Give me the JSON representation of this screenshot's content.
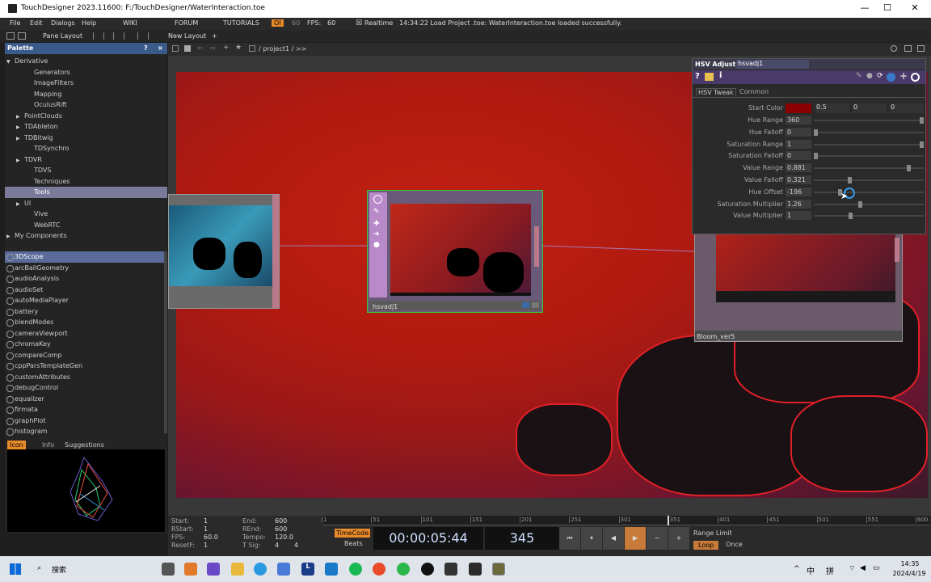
{
  "window": {
    "title": "TouchDesigner 2023.11600: F:/TouchDesigner/WaterInteraction.toe",
    "minimize": "—",
    "maximize": "☐",
    "close": "✕"
  },
  "menubar": {
    "items": [
      "File",
      "Edit",
      "Dialogs",
      "Help"
    ],
    "links": [
      "WIKI",
      "FORUM",
      "TUTORIALS"
    ],
    "oi": "OI",
    "sixty": "60",
    "fps_label": "FPS:",
    "fps_value": "60",
    "realtime": "Realtime",
    "status": "14:34:22 Load Project .toe: WaterInteraction.toe loaded successfully."
  },
  "toolbar": {
    "pane_layout": "Pane Layout",
    "new_layout": "New Layout",
    "add": "+"
  },
  "palette": {
    "title": "Palette",
    "help": "?",
    "close": "×",
    "tree": [
      {
        "label": "Derivative",
        "indent": 0,
        "arrow": "▼"
      },
      {
        "label": "Generators",
        "indent": 2,
        "arrow": ""
      },
      {
        "label": "ImageFilters",
        "indent": 2,
        "arrow": ""
      },
      {
        "label": "Mapping",
        "indent": 2,
        "arrow": ""
      },
      {
        "label": "OculusRift",
        "indent": 2,
        "arrow": ""
      },
      {
        "label": "PointClouds",
        "indent": 1,
        "arrow": "▶"
      },
      {
        "label": "TDAbleton",
        "indent": 1,
        "arrow": "▶"
      },
      {
        "label": "TDBitwig",
        "indent": 1,
        "arrow": "▶"
      },
      {
        "label": "TDSynchro",
        "indent": 2,
        "arrow": ""
      },
      {
        "label": "TDVR",
        "indent": 1,
        "arrow": "▶"
      },
      {
        "label": "TDVS",
        "indent": 2,
        "arrow": ""
      },
      {
        "label": "Techniques",
        "indent": 2,
        "arrow": ""
      },
      {
        "label": "Tools",
        "indent": 2,
        "arrow": "",
        "selected": true
      },
      {
        "label": "UI",
        "indent": 1,
        "arrow": "▶"
      },
      {
        "label": "Vive",
        "indent": 2,
        "arrow": ""
      },
      {
        "label": "WebRTC",
        "indent": 2,
        "arrow": ""
      },
      {
        "label": "My Components",
        "indent": 0,
        "arrow": "▶"
      }
    ],
    "components": [
      "3DScope",
      "arcBallGeometry",
      "audioAnalysis",
      "audioSet",
      "autoMediaPlayer",
      "battery",
      "blendModes",
      "cameraViewport",
      "chromaKey",
      "compareComp",
      "cppParsTemplateGen",
      "customAttributes",
      "debugControl",
      "equalizer",
      "firmata",
      "graphPlot",
      "histogram"
    ],
    "tabs": [
      "Icon",
      "Info",
      "Suggestions"
    ]
  },
  "network": {
    "path": "/ project1 / >>",
    "nodes": [
      {
        "name": "hsvadj1"
      },
      {
        "name": "Bloom_ver5"
      }
    ]
  },
  "params": {
    "type": "HSV Adjust",
    "name": "hsvadj1",
    "tabs": [
      "HSV Tweak",
      "Common"
    ],
    "start_color": {
      "label": "Start Color",
      "swatch": "#8b0000",
      "values": [
        "0.5",
        "0",
        "0"
      ]
    },
    "rows": [
      {
        "label": "Hue Range",
        "value": "360",
        "level": 1.0
      },
      {
        "label": "Hue Falloff",
        "value": "0",
        "level": 0.0
      },
      {
        "label": "Saturation Range",
        "value": "1",
        "level": 1.0
      },
      {
        "label": "Saturation Falloff",
        "value": "0",
        "level": 0.0
      },
      {
        "label": "Value Range",
        "value": "0.881",
        "level": 0.88
      },
      {
        "label": "Value Falloff",
        "value": "0.321",
        "level": 0.32
      },
      {
        "label": "Hue Offset",
        "value": "-196",
        "level": 0.23
      },
      {
        "label": "Saturation Multiplier",
        "value": "1.26",
        "level": 0.42
      },
      {
        "label": "Value Multiplier",
        "value": "1",
        "level": 0.33
      }
    ]
  },
  "timeline": {
    "start_label": "Start:",
    "start": "1",
    "end_label": "End:",
    "end": "600",
    "rstart_label": "RStart:",
    "rstart": "1",
    "rend_label": "REnd:",
    "rend": "600",
    "fps_label": "FPS:",
    "fps": "60.0",
    "tempo_label": "Tempo:",
    "tempo": "120.0",
    "resetf_label": "ResetF:",
    "resetf": "1",
    "tsig_label": "T Sig:",
    "tsig1": "4",
    "tsig2": "4",
    "ticks": [
      "1",
      "51",
      "101",
      "151",
      "201",
      "251",
      "301",
      "351",
      "401",
      "451",
      "501",
      "551",
      "600"
    ],
    "timecode_btn": "TimeCode",
    "beats_btn": "Beats",
    "timecode": "00:00:05:44",
    "frame": "345",
    "range_limit": "Range Limit",
    "loop": "Loop",
    "once": "Once"
  },
  "taskbar": {
    "search": "搜索",
    "ime1": "中",
    "ime2": "拼",
    "time": "14:35",
    "date": "2024/4/19",
    "icons": [
      "widgets",
      "task-view",
      "chat",
      "explorer",
      "edge",
      "store",
      "l-app",
      "pen-app",
      "spotify",
      "firefox",
      "wechat",
      "unreal",
      "vs",
      "capture",
      "touchdesigner"
    ]
  }
}
